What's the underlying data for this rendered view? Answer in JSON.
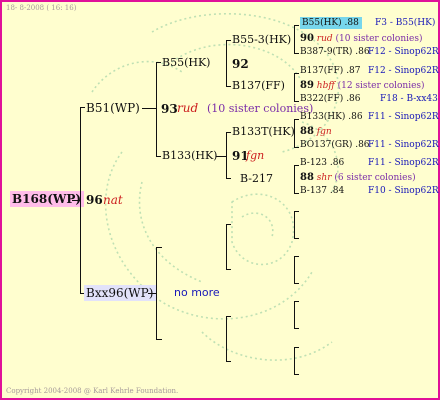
{
  "header": {
    "date_line": "18-  8-2008 ( 16: 16)"
  },
  "footer": {
    "copyright": "Copyright 2004-2008 @ Karl Kehrle Foundation."
  },
  "colors": {
    "border": "#e0109a",
    "background": "#fffecf",
    "highlight_root": "#ffbde9",
    "highlight_top": "#77d6ec",
    "highlight_mother": "#e2e2fa",
    "queen_note": "#cc1f1f",
    "stat": "#1818b8"
  },
  "root": {
    "label": "B168(WP)",
    "score": "96",
    "note": "nat"
  },
  "gen1": {
    "father": {
      "label": "B51(WP)",
      "score": "93",
      "note": "rud",
      "sister": "(10 sister colonies)"
    },
    "mother": {
      "label": "Bxx96(WP)",
      "more": "no more"
    }
  },
  "gen2": {
    "ff": {
      "label": "B55(HK)",
      "score": "92"
    },
    "fm": {
      "label": "B133(HK)",
      "score": "91",
      "note": "fgn"
    }
  },
  "gen3": {
    "fff": {
      "label": "B55-3(HK)"
    },
    "ffm": {
      "label": "B137(FF)"
    },
    "fmf": {
      "label": "B133T(HK)",
      "score": "88",
      "note": "fgn"
    },
    "fmm": {
      "label": "B-217"
    }
  },
  "gen4": {
    "r1": {
      "name": "B55(HK)",
      "val": ".88",
      "stat": "F3 - B55(HK)"
    },
    "r2": {
      "score": "90",
      "note": "rud",
      "sister": "(10 sister colonies)"
    },
    "r3": {
      "name": "B387-9(TR)",
      "val": ".86",
      "stat": "F12 - Sinop62R"
    },
    "r4": {
      "name": "B137(FF)",
      "val": ".87",
      "stat": "F12 - Sinop62R"
    },
    "r5": {
      "score": "89",
      "note": "hbff",
      "sister": "(12 sister colonies)"
    },
    "r6": {
      "name": "B322(FF)",
      "val": ".86",
      "stat": "F18 - B-xx43"
    },
    "r7": {
      "name": "B133(HK)",
      "val": ".86",
      "stat": "F11 - Sinop62R"
    },
    "r8": {
      "name": "BO137(GR)",
      "val": ".86",
      "stat": "F11 - Sinop62R"
    },
    "r9": {
      "name": "B-123",
      "val": ".86",
      "stat": "F11 - Sinop62R"
    },
    "r10": {
      "score": "88",
      "note": "shr",
      "sister": "(6 sister colonies)"
    },
    "r11": {
      "name": "B-137",
      "val": ".84",
      "stat": "F10 - Sinop62R"
    }
  }
}
